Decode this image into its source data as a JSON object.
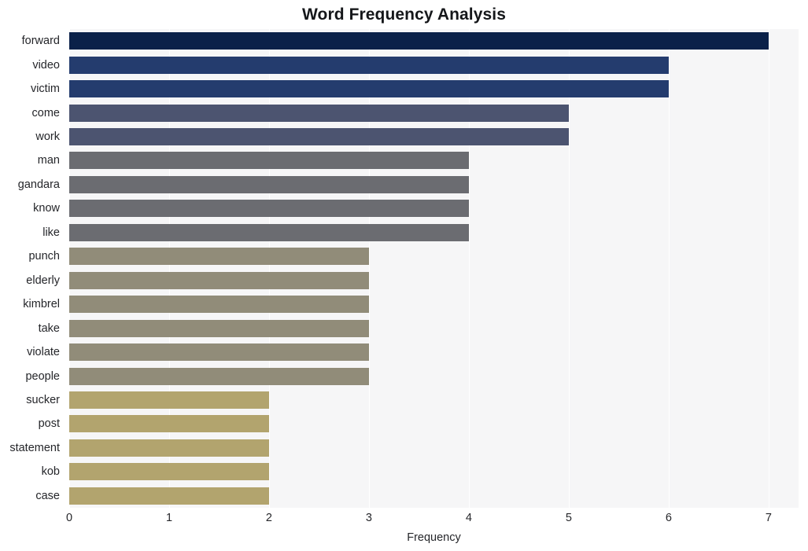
{
  "chart_data": {
    "type": "bar",
    "orientation": "horizontal",
    "title": "Word Frequency Analysis",
    "xlabel": "Frequency",
    "ylabel": "",
    "xlim": [
      0,
      7.3
    ],
    "xticks": [
      0,
      1,
      2,
      3,
      4,
      5,
      6,
      7
    ],
    "xtick_labels": [
      "0",
      "1",
      "2",
      "3",
      "4",
      "5",
      "6",
      "7"
    ],
    "grid": "vertical",
    "legend": "none",
    "categories": [
      "forward",
      "video",
      "victim",
      "come",
      "work",
      "man",
      "gandara",
      "know",
      "like",
      "punch",
      "elderly",
      "kimbrel",
      "take",
      "violate",
      "people",
      "sucker",
      "post",
      "statement",
      "kob",
      "case"
    ],
    "values": [
      7,
      6,
      6,
      5,
      5,
      4,
      4,
      4,
      4,
      3,
      3,
      3,
      3,
      3,
      3,
      2,
      2,
      2,
      2,
      2
    ],
    "bar_colors": [
      "#0b2149",
      "#243c6e",
      "#243c6e",
      "#4c5470",
      "#4c5470",
      "#6b6c71",
      "#6b6c71",
      "#6b6c71",
      "#6b6c71",
      "#918c79",
      "#918c79",
      "#918c79",
      "#918c79",
      "#918c79",
      "#918c79",
      "#b2a46e",
      "#b2a46e",
      "#b2a46e",
      "#b2a46e",
      "#b2a46e"
    ]
  },
  "style": {
    "plot_background": "#f6f6f7",
    "figure_background": "#ffffff",
    "gridline_color": "#ffffff",
    "tick_text_color": "#25262a",
    "title_color": "#15171a"
  }
}
